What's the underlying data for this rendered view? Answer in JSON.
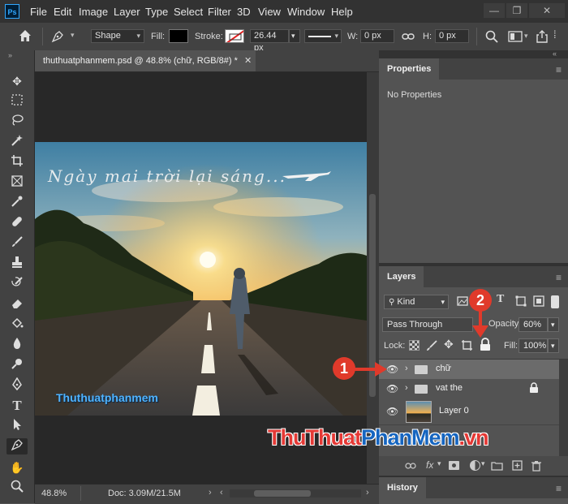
{
  "app": {
    "logo": "Ps"
  },
  "menu": [
    "File",
    "Edit",
    "Image",
    "Layer",
    "Type",
    "Select",
    "Filter",
    "3D",
    "View",
    "Window",
    "Help"
  ],
  "options": {
    "mode": "Shape",
    "fill_label": "Fill:",
    "stroke_label": "Stroke:",
    "stroke_width": "26.44 px",
    "w_label": "W:",
    "w_value": "0 px",
    "h_label": "H:",
    "h_value": "0 px"
  },
  "document": {
    "tab_title": "thuthuatphanmem.psd @ 48.8% (chữ, RGB/8#) *",
    "caption": "Ngày mai trời lại sáng...",
    "watermark": "Thuthuatphanmem",
    "zoom": "48.8%",
    "doc_info": "Doc: 3.09M/21.5M"
  },
  "properties": {
    "title": "Properties",
    "empty": "No Properties"
  },
  "layers": {
    "title": "Layers",
    "filter": "Kind",
    "blend_mode": "Pass Through",
    "opacity_label": "Opacity:",
    "opacity": "60%",
    "lock_label": "Lock:",
    "fill_label": "Fill:",
    "fill": "100%",
    "items": [
      {
        "name": "chữ",
        "type": "group",
        "selected": true
      },
      {
        "name": "vat the",
        "type": "group",
        "locked": true
      },
      {
        "name": "Layer 0",
        "type": "pixel"
      }
    ]
  },
  "history": {
    "title": "History"
  },
  "annotations": {
    "one": "1",
    "two": "2"
  },
  "brand": {
    "part1": "ThuThuat",
    "part2": "PhanMem",
    "part3": ".vn"
  },
  "colors": {
    "brand_red": "#e53935",
    "brand_blue": "#1565c0",
    "accent": "#31a8ff"
  }
}
